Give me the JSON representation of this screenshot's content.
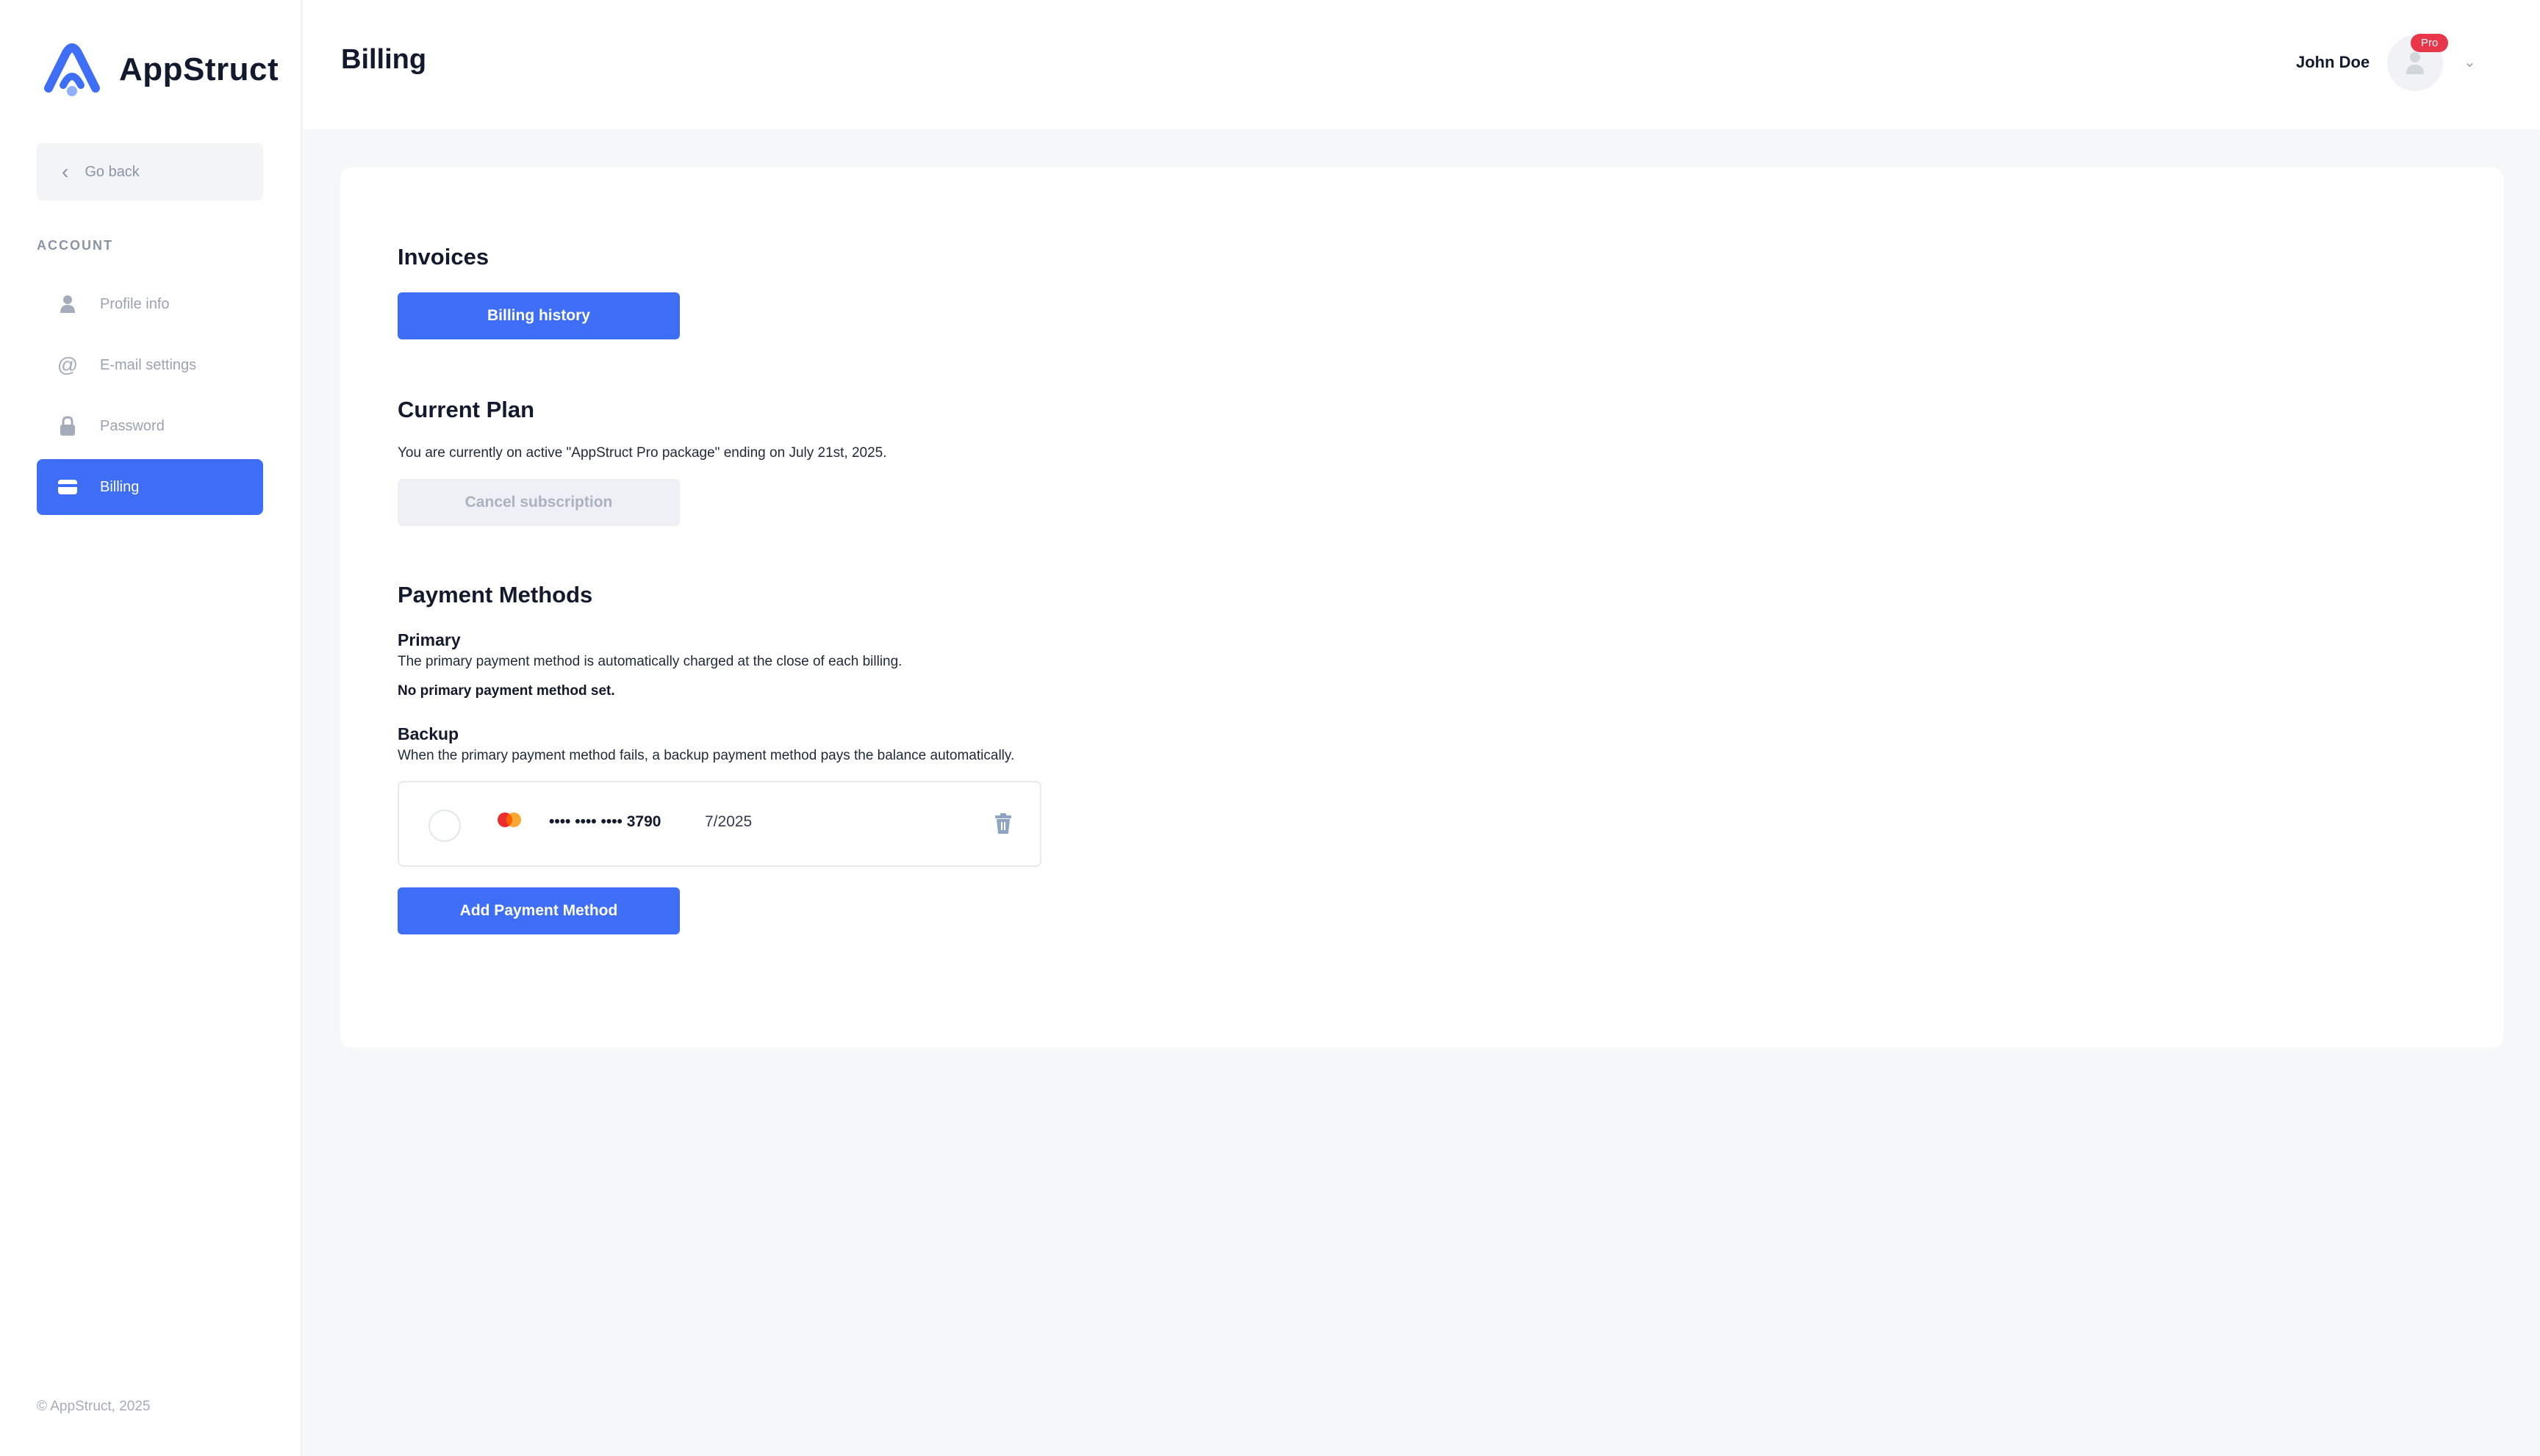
{
  "app": {
    "name": "AppStruct",
    "accent_color": "#3d6ef5",
    "badge_color": "#e8364a"
  },
  "sidebar": {
    "go_back_label": "Go back",
    "section_label": "ACCOUNT",
    "items": [
      {
        "label": "Profile info",
        "icon": "user-icon",
        "active": false
      },
      {
        "label": "E-mail settings",
        "icon": "at-sign-icon",
        "active": false
      },
      {
        "label": "Password",
        "icon": "lock-icon",
        "active": false
      },
      {
        "label": "Billing",
        "icon": "credit-card-icon",
        "active": true
      }
    ],
    "copyright": "© AppStruct, 2025"
  },
  "header": {
    "title": "Billing",
    "user_name": "John Doe",
    "badge": "Pro"
  },
  "invoices": {
    "title": "Invoices",
    "button_label": "Billing history"
  },
  "current_plan": {
    "title": "Current Plan",
    "description": "You are currently on active \"AppStruct Pro package\" ending on July 21st, 2025.",
    "cancel_label": "Cancel subscription"
  },
  "payment_methods": {
    "title": "Payment Methods",
    "primary": {
      "title": "Primary",
      "description": "The primary payment method is automatically charged at the close of each billing.",
      "empty_text": "No primary payment method set."
    },
    "backup": {
      "title": "Backup",
      "description": "When the primary payment method fails, a backup payment method pays the balance automatically.",
      "card": {
        "brand_icon": "mastercard-icon",
        "masked_number": "•••• •••• •••• 3790",
        "expiry": "7/2025"
      }
    },
    "add_label": "Add Payment Method"
  }
}
